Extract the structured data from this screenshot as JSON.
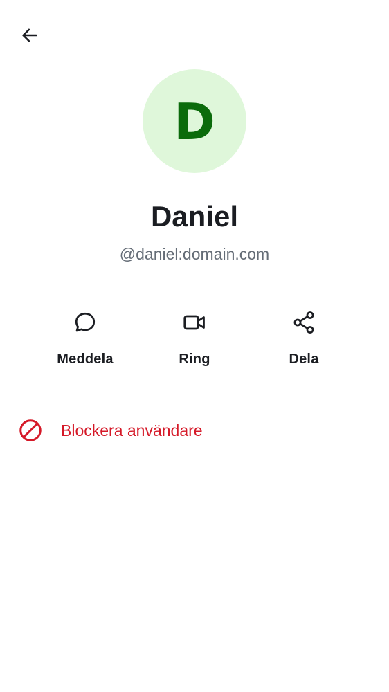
{
  "header": {
    "back_icon": "arrow-left-icon"
  },
  "profile": {
    "avatar_initial": "D",
    "avatar_bg": "#dff7da",
    "avatar_fg": "#0b6b0b",
    "display_name": "Daniel",
    "user_id": "@daniel:domain.com"
  },
  "actions": [
    {
      "label": "Meddela",
      "icon": "chat-bubble-icon"
    },
    {
      "label": "Ring",
      "icon": "video-camera-icon"
    },
    {
      "label": "Dela",
      "icon": "share-icon"
    }
  ],
  "block": {
    "label": "Blockera användare",
    "icon": "block-icon",
    "color": "#d51928"
  }
}
